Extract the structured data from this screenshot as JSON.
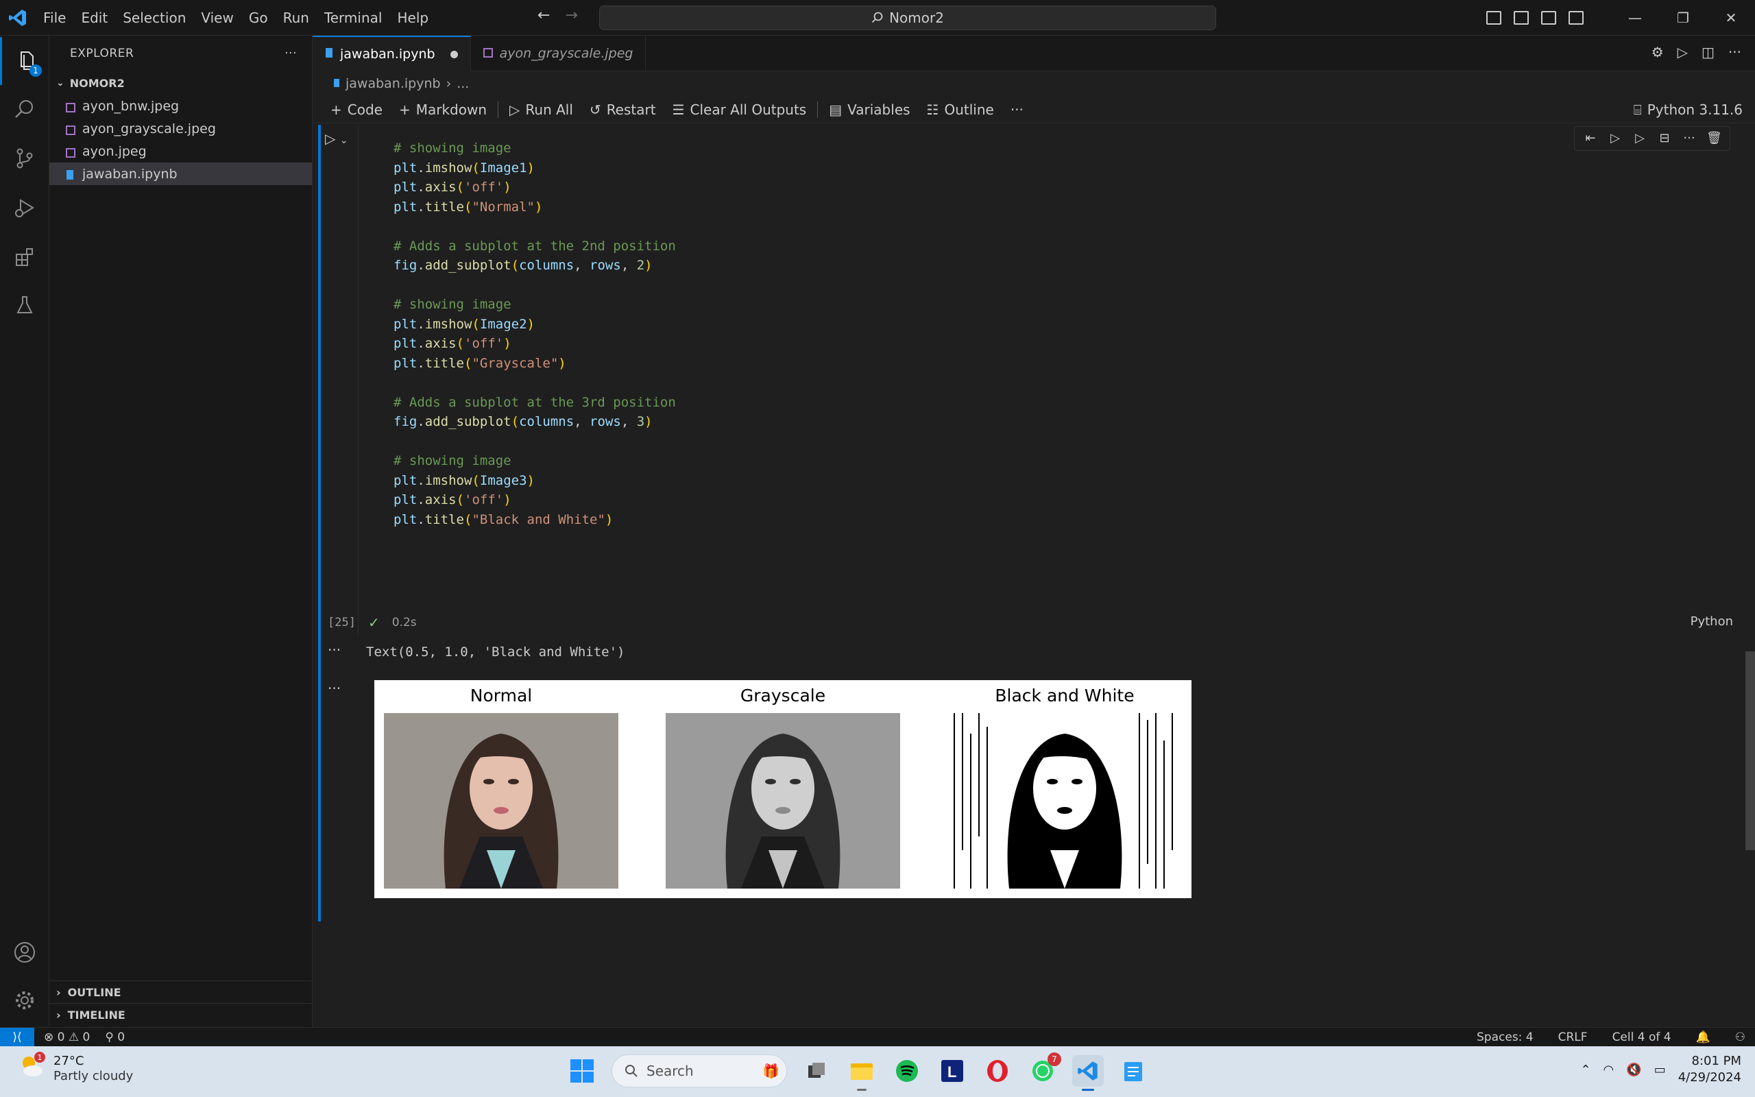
{
  "titlebar": {
    "menu": [
      "File",
      "Edit",
      "Selection",
      "View",
      "Go",
      "Run",
      "Terminal",
      "Help"
    ],
    "command_center": "Nomor2"
  },
  "activity": {
    "explorer_badge": "1"
  },
  "sidebar": {
    "title": "EXPLORER",
    "folder": "NOMOR2",
    "files": [
      "ayon_bnw.jpeg",
      "ayon_grayscale.jpeg",
      "ayon.jpeg",
      "jawaban.ipynb"
    ],
    "outline": "OUTLINE",
    "timeline": "TIMELINE"
  },
  "tabs": [
    {
      "label": "jawaban.ipynb"
    },
    {
      "label": "ayon_grayscale.jpeg"
    }
  ],
  "breadcrumb": {
    "file": "jawaban.ipynb",
    "rest": "..."
  },
  "toolbar": {
    "code": "Code",
    "markdown": "Markdown",
    "run_all": "Run All",
    "restart": "Restart",
    "clear": "Clear All Outputs",
    "variables": "Variables",
    "outline": "Outline",
    "kernel": "Python 3.11.6"
  },
  "cell": {
    "exec_count": "[25]",
    "duration": "0.2s",
    "language": "Python",
    "output_text": "Text(0.5, 1.0, 'Black and White')",
    "figure_titles": [
      "Normal",
      "Grayscale",
      "Black and White"
    ]
  },
  "statusbar": {
    "errors": "0",
    "warnings": "0",
    "ports": "0",
    "spaces": "Spaces: 4",
    "eol": "CRLF",
    "cell_pos": "Cell 4 of 4"
  },
  "taskbar": {
    "temperature": "27°C",
    "weather": "Partly cloudy",
    "weather_badge": "1",
    "search_placeholder": "Search",
    "whatsapp_badge": "7",
    "time": "8:01 PM",
    "date": "4/29/2024"
  },
  "colors": {
    "accent": "#0078d4",
    "background": "#1f1f1f",
    "sidebar": "#181818",
    "taskbar": "#d9e3ee"
  }
}
